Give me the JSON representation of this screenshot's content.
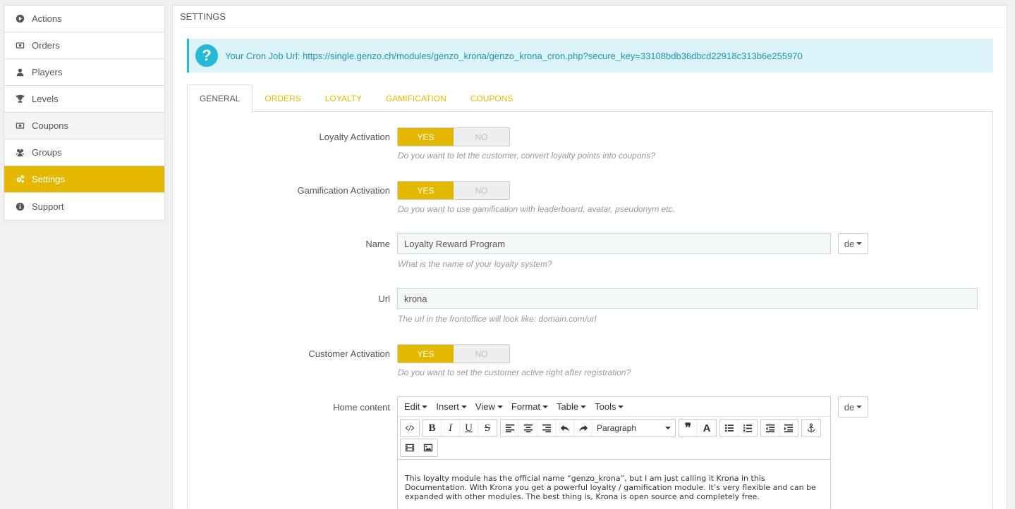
{
  "sidebar": {
    "items": [
      {
        "label": "Actions",
        "icon": "play-circle-icon"
      },
      {
        "label": "Orders",
        "icon": "money-icon"
      },
      {
        "label": "Players",
        "icon": "user-icon"
      },
      {
        "label": "Levels",
        "icon": "trophy-icon"
      },
      {
        "label": "Coupons",
        "icon": "money-icon"
      },
      {
        "label": "Groups",
        "icon": "users-icon"
      },
      {
        "label": "Settings",
        "icon": "cogs-icon",
        "active": true
      },
      {
        "label": "Support",
        "icon": "info-circle-icon"
      }
    ]
  },
  "panel": {
    "heading": "SETTINGS",
    "alert": {
      "text": "Your Cron Job Url: https://single.genzo.ch/modules/genzo_krona/genzo_krona_cron.php?secure_key=33108bdb36dbcd22918c313b6e255970"
    },
    "tabs": [
      "GENERAL",
      "ORDERS",
      "LOYALTY",
      "GAMIFICATION",
      "COUPONS"
    ]
  },
  "form": {
    "loyalty_activation": {
      "label": "Loyalty Activation",
      "yes": "YES",
      "no": "NO",
      "help": "Do you want to let the customer, convert loyalty points into coupons?"
    },
    "gamification_activation": {
      "label": "Gamification Activation",
      "yes": "YES",
      "no": "NO",
      "help": "Do you want to use gamification with leaderboard, avatar, pseudonym etc."
    },
    "name": {
      "label": "Name",
      "value": "Loyalty Reward Program",
      "lang": "de",
      "help": "What is the name of your loyalty system?"
    },
    "url": {
      "label": "Url",
      "value": "krona",
      "help": "The url in the frontoffice will look like: domain.com/url"
    },
    "customer_activation": {
      "label": "Customer Activation",
      "yes": "YES",
      "no": "NO",
      "help": "Do you want to set the customer active right after registration?"
    },
    "home_content": {
      "label": "Home content",
      "lang": "de",
      "menu": [
        "Edit",
        "Insert",
        "View",
        "Format",
        "Table",
        "Tools"
      ],
      "format_select": "Paragraph",
      "content": "This loyalty module has the official name “genzo_krona”, but I am just calling it Krona in this Documentation. With Krona you get a powerful loyalty / gamification module. It’s very flexible and can be expanded with other modules. The best thing is, Krona is open source and completely free."
    }
  },
  "colors": {
    "accent": "#e5b800",
    "info": "#25b9d7"
  }
}
